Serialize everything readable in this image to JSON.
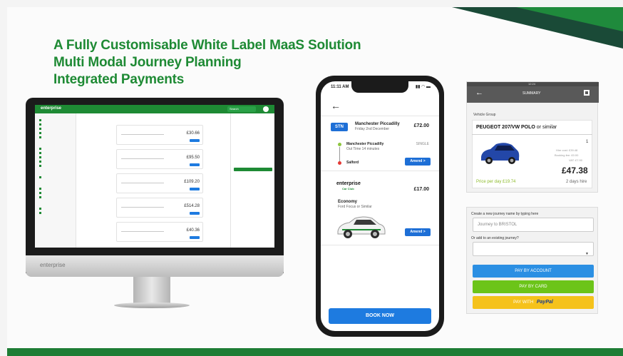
{
  "headlines": [
    "A Fully Customisable White Label MaaS Solution",
    "Multi Modal Journey Planning",
    "Integrated Payments"
  ],
  "desktop": {
    "brand": "enterprise",
    "search_label": "Search",
    "card_prices": [
      "£30.66",
      "£95.50",
      "£109.20",
      "£514.28",
      "£40.36"
    ]
  },
  "phone": {
    "status_time": "11:11 AM",
    "status_icons": "▮▮ ◠ ▬",
    "train": {
      "badge": "STN",
      "title": "Manchester Piccadilly",
      "subtitle": "Friday 2nd December",
      "price": "£72.00",
      "from": "Manchester Piccadilly",
      "duration": "Out Time 14 minutes",
      "to": "Salford",
      "ticket_type": "SINGLE",
      "amend_label": "Amend >"
    },
    "car": {
      "brand": "enterprise",
      "brand_sub": "Car Club",
      "price": "£17.00",
      "title": "Economy",
      "subtitle": "Ford Focus or Similar",
      "amend_label": "Amend >"
    },
    "book_label": "BOOK NOW"
  },
  "summary_panel": {
    "time": "12:24",
    "title": "SUMMARY",
    "vehicle_group_label": "Vehicle Group",
    "car_name_bold": "PEUGEOT 207/VW POLO",
    "car_name_rest": " or similar",
    "quantity": "1",
    "hire_cost": "Hire cost: £39.48",
    "booking_fee": "Booking fee: £0.00",
    "vat": "VAT: £7.90",
    "total": "£47.38",
    "per_day": "Price per day £19.74",
    "days": "2 days hire"
  },
  "journey_panel": {
    "name_label": "Create a new journey name by typing here",
    "name_value": "Journey to BRISTOL",
    "existing_label": "Or add to an existing journey?",
    "pay_account": "PAY BY ACCOUNT",
    "pay_card": "PAY BY CARD",
    "pay_with": "PAY WITH",
    "paypal": "PayPal",
    "colors": {
      "account": "#2b8fe3",
      "card": "#6cc419",
      "paypal": "#f5c21b"
    }
  }
}
